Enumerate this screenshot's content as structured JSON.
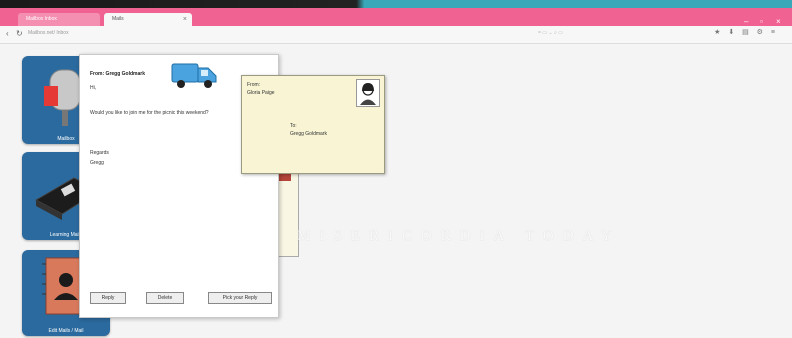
{
  "browser": {
    "tabs": [
      {
        "label": "Mailbox Inbox"
      },
      {
        "label": "Mails"
      }
    ],
    "address": "Mailbox.net/ Inbox",
    "toolbar_hint": "= ▭ ⌄ ⌕ ▭"
  },
  "tiles": [
    {
      "label": "Mailbox",
      "icon": "mailbox-icon"
    },
    {
      "label": "Learning Mails",
      "icon": "book-icon"
    },
    {
      "label": "Edit Mails / Mail",
      "icon": "address-book-icon"
    }
  ],
  "dialog": {
    "title": "From: Gregg Goldmark",
    "greeting": "Hi,",
    "body": "Would you like to join me for the picnic this weekend?",
    "sign_off": "Regards",
    "signature": "Gregg",
    "buttons": {
      "reply": "Reply",
      "delete": "Delete",
      "forward": "Pick your Reply"
    }
  },
  "note": {
    "from_label": "From:",
    "from_name": "Gloria Paige",
    "to_label": "To:",
    "to_name": "Gregg Goldmark"
  },
  "watermark": "MISERICORDIA TODAY"
}
